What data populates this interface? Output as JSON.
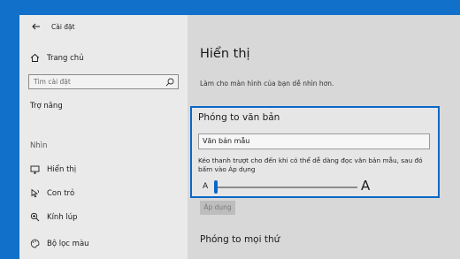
{
  "window": {
    "app_title": "Cài đặt"
  },
  "sidebar": {
    "home_label": "Trang chủ",
    "search_placeholder": "Tìm cài đặt",
    "category_label": "Trợ năng",
    "section_label": "Nhìn",
    "items": [
      {
        "label": "Hiển thị",
        "icon": "monitor-icon"
      },
      {
        "label": "Con trỏ",
        "icon": "cursor-icon"
      },
      {
        "label": "Kính lúp",
        "icon": "magnifier-icon"
      },
      {
        "label": "Bộ lọc màu",
        "icon": "palette-icon"
      }
    ]
  },
  "main": {
    "title": "Hiển thị",
    "subtitle": "Làm cho màn hình của bạn dễ nhìn hơn.",
    "text_size_card": {
      "title": "Phóng to văn bản",
      "sample_text": "Văn bản mẫu",
      "hint": "Kéo thanh trượt cho đến khi có thể dễ dàng đọc văn bản mẫu, sau đó bấm vào Áp dụng",
      "small_label": "A",
      "large_label": "A",
      "slider_value": 0
    },
    "apply_label": "Áp dụng",
    "section2_title": "Phóng to mọi thứ"
  },
  "colors": {
    "accent": "#0a67c8",
    "desktop": "#1170c9"
  }
}
